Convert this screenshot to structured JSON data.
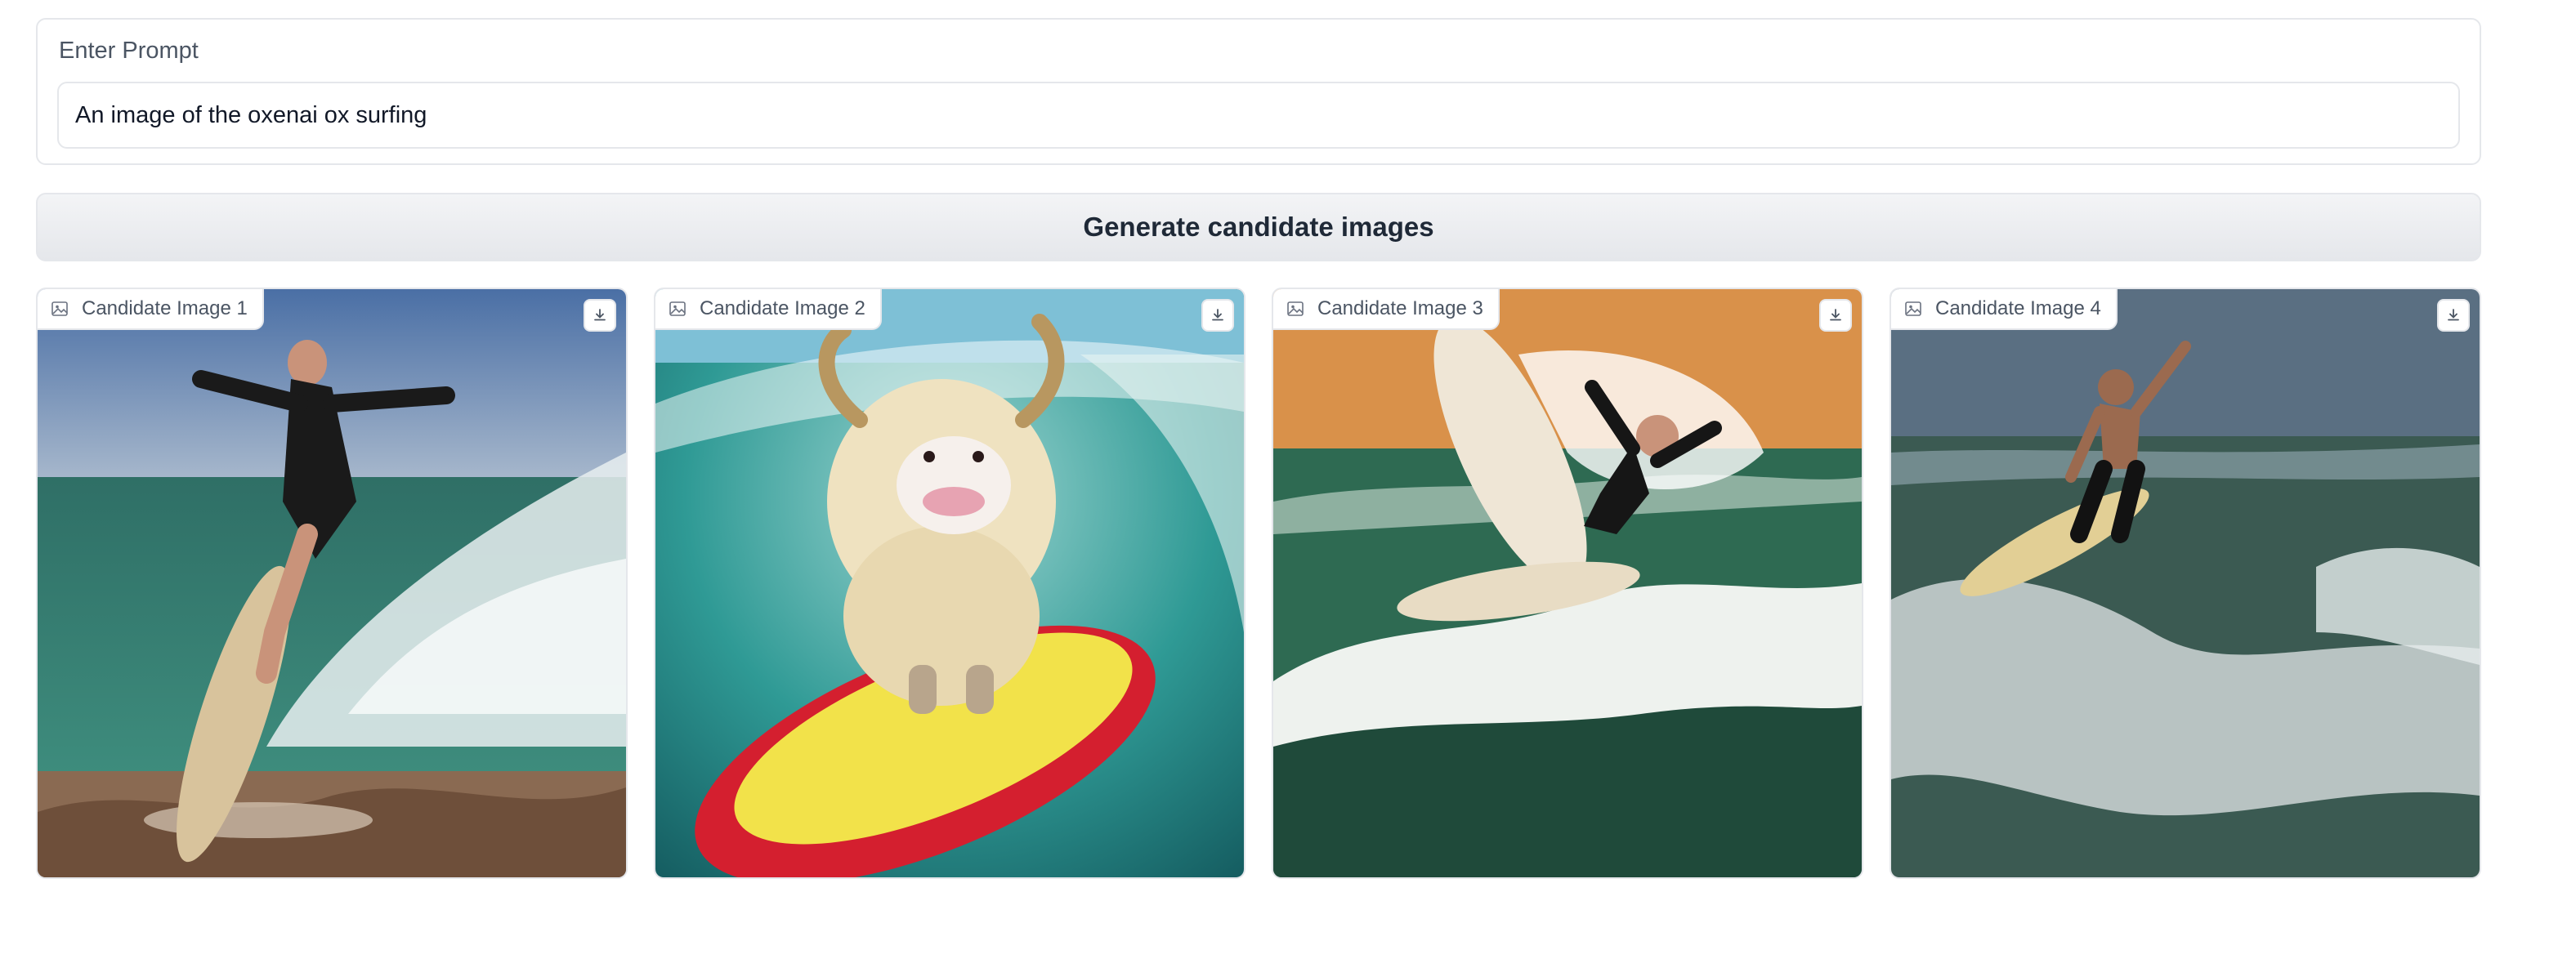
{
  "prompt": {
    "label": "Enter Prompt",
    "value": "An image of the oxenai ox surfing"
  },
  "generate_button": {
    "label": "Generate candidate images"
  },
  "gallery": {
    "items": [
      {
        "label": "Candidate Image 1",
        "image_icon": "image-icon",
        "download_icon": "download-icon"
      },
      {
        "label": "Candidate Image 2",
        "image_icon": "image-icon",
        "download_icon": "download-icon"
      },
      {
        "label": "Candidate Image 3",
        "image_icon": "image-icon",
        "download_icon": "download-icon"
      },
      {
        "label": "Candidate Image 4",
        "image_icon": "image-icon",
        "download_icon": "download-icon"
      }
    ]
  },
  "colors": {
    "border": "#e5e7eb",
    "button_bg": "#e5e7eb",
    "text": "#374151"
  }
}
